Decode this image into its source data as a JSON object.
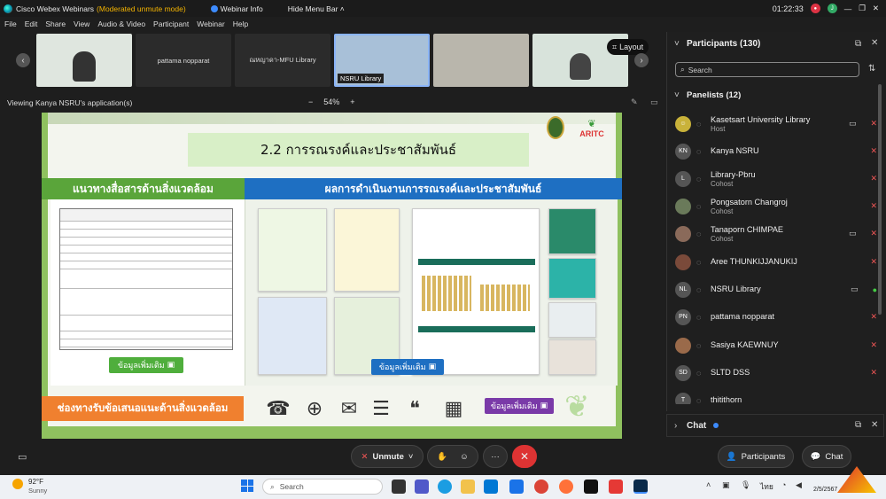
{
  "titlebar": {
    "app_name": "Cisco Webex Webinars",
    "mode": "(Moderated unmute mode)",
    "webinar_info": "Webinar Info",
    "hide_menu": "Hide Menu Bar",
    "time": "01:22:33"
  },
  "menu": [
    "File",
    "Edit",
    "Share",
    "View",
    "Audio & Video",
    "Participant",
    "Webinar",
    "Help"
  ],
  "video_strip": {
    "tiles": [
      "pattama nopparat",
      "ณหญาดา-MFU Library",
      "NSRU Library"
    ],
    "layout_label": "Layout"
  },
  "viewing": {
    "label": "Viewing Kanya NSRU's application(s)",
    "zoom": "54%"
  },
  "slide": {
    "title": "2.2 การรณรงค์และประชาสัมพันธ์",
    "logo_text": "ARITC",
    "left_header": "แนวทางสื่อสารด้านสิ่งแวดล้อม",
    "right_header": "ผลการดำเนินงานการรณรงค์และประชาสัมพันธ์",
    "more_label": "ข้อมูลเพิ่มเติม",
    "bottom_label": "ช่องทางรับข้อเสนอแนะด้านสิ่งแวดล้อม",
    "channel_icons": [
      "phone-icon",
      "globe-icon",
      "email-icon",
      "document-icon",
      "chat-icon",
      "qr-code-icon"
    ],
    "colors": {
      "green": "#5aa53a",
      "blue": "#1e6fc2",
      "orange": "#f0802f",
      "purple": "#7a3aa8"
    }
  },
  "controls": {
    "unmute": "Unmute",
    "participants": "Participants",
    "chat": "Chat"
  },
  "panel": {
    "title": "Participants (130)",
    "search_placeholder": "Search",
    "panelists_header": "Panelists (12)",
    "panelists": [
      {
        "name": "Kasetsart University Library",
        "role": "Host",
        "initials": "",
        "color": "#c9b23a"
      },
      {
        "name": "Kanya NSRU",
        "role": "",
        "initials": "KN",
        "color": "#555"
      },
      {
        "name": "Library-Pbru",
        "role": "Cohost",
        "initials": "L",
        "color": "#555"
      },
      {
        "name": "Pongsatorn Changroj",
        "role": "Cohost",
        "initials": "",
        "color": "#6a7a5a"
      },
      {
        "name": "Tanaporn CHIMPAE",
        "role": "Cohost",
        "initials": "",
        "color": "#8a6a5a"
      },
      {
        "name": "Aree THUNKIJJANUKIJ",
        "role": "",
        "initials": "",
        "color": "#7a4a3a"
      },
      {
        "name": "NSRU Library",
        "role": "",
        "initials": "NL",
        "color": "#555"
      },
      {
        "name": "pattama nopparat",
        "role": "",
        "initials": "PN",
        "color": "#555"
      },
      {
        "name": "Sasiya KAEWNUY",
        "role": "",
        "initials": "",
        "color": "#9a6a4a"
      },
      {
        "name": "SLTD DSS",
        "role": "",
        "initials": "SD",
        "color": "#555"
      },
      {
        "name": "thitithorn",
        "role": "",
        "initials": "T",
        "color": "#555"
      }
    ],
    "chat_label": "Chat"
  },
  "taskbar": {
    "weather_temp": "92°F",
    "weather_desc": "Sunny",
    "search_placeholder": "Search",
    "lang": "ไทย",
    "date": "2/5/2567"
  }
}
